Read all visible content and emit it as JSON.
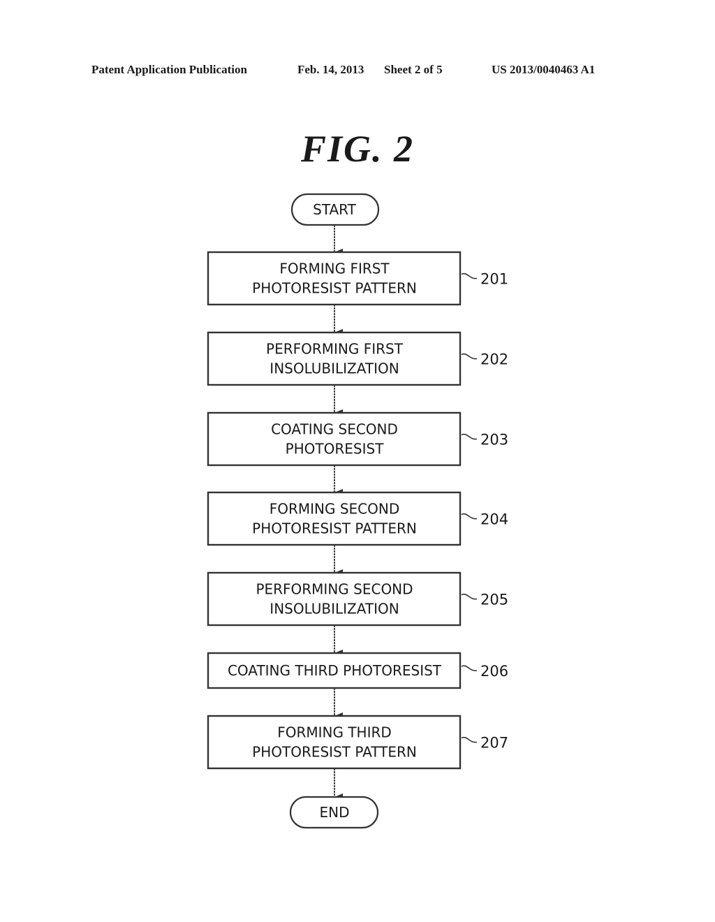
{
  "header": {
    "left": "Patent Application Publication",
    "date": "Feb. 14, 2013",
    "sheet": "Sheet 2 of 5",
    "pub_number": "US 2013/0040463 A1"
  },
  "figure": {
    "title": "FIG. 2",
    "start": "START",
    "end": "END",
    "steps": [
      {
        "ref": "201",
        "lines": [
          "FORMING FIRST",
          "PHOTORESIST PATTERN"
        ]
      },
      {
        "ref": "202",
        "lines": [
          "PERFORMING FIRST",
          "INSOLUBILIZATION"
        ]
      },
      {
        "ref": "203",
        "lines": [
          "COATING SECOND",
          "PHOTORESIST"
        ]
      },
      {
        "ref": "204",
        "lines": [
          "FORMING SECOND",
          "PHOTORESIST PATTERN"
        ]
      },
      {
        "ref": "205",
        "lines": [
          "PERFORMING SECOND",
          "INSOLUBILIZATION"
        ]
      },
      {
        "ref": "206",
        "lines": [
          "COATING THIRD PHOTORESIST"
        ]
      },
      {
        "ref": "207",
        "lines": [
          "FORMING THIRD",
          "PHOTORESIST PATTERN"
        ]
      }
    ]
  }
}
